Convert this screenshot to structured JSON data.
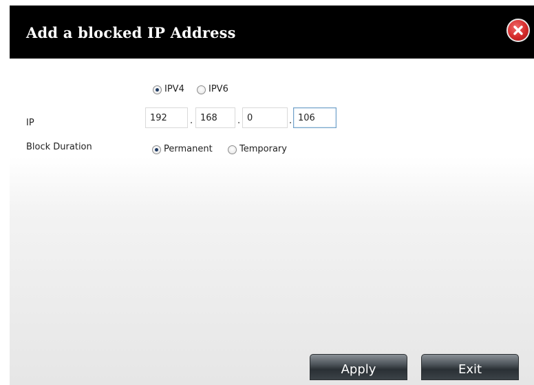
{
  "dialog": {
    "title": "Add a blocked IP Address"
  },
  "ip_version": {
    "options": [
      "IPV4",
      "IPV6"
    ],
    "selected": "IPV4"
  },
  "ip": {
    "label": "IP",
    "octets": [
      "192",
      "168",
      "0",
      "106"
    ],
    "separator": "."
  },
  "block_duration": {
    "label": "Block Duration",
    "options": [
      "Permanent",
      "Temporary"
    ],
    "selected": "Permanent"
  },
  "buttons": {
    "apply": "Apply",
    "exit": "Exit"
  },
  "icons": {
    "close": "close-icon"
  },
  "colors": {
    "titlebar": "#000000",
    "close_button": "#d42a2a",
    "button_dark": "#2a3035",
    "focus_border": "#6fa0c8"
  }
}
